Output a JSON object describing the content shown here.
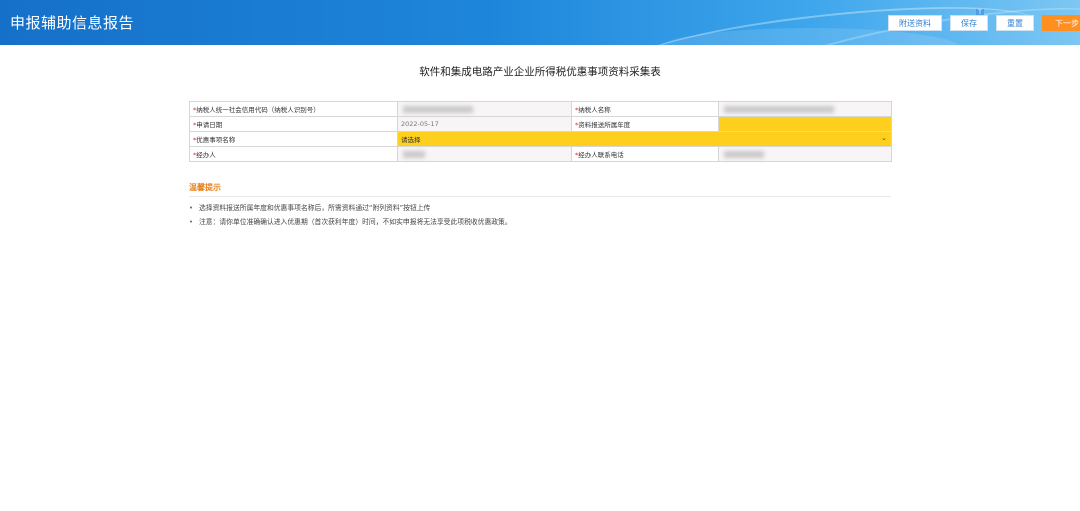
{
  "app": {
    "title": "申报辅助信息报告"
  },
  "toolbar": {
    "attach": "附送资料",
    "save": "保存",
    "reset": "重置",
    "next": "下一步",
    "badge": "T"
  },
  "form": {
    "title": "软件和集成电路产业企业所得税优惠事项资料采集表",
    "required_mark": "*",
    "rows": [
      {
        "label1": "纳税人统一社会信用代码（纳税人识别号）",
        "value1": "",
        "label2": "纳税人名称",
        "value2": ""
      },
      {
        "label1": "申请日期",
        "value1": "2022-05-17",
        "label2": "资料报送所属年度",
        "value2": ""
      },
      {
        "label1": "优惠事项名称",
        "select_value": "请选择"
      },
      {
        "label1": "经办人",
        "value1": "",
        "label2": "经办人联系电话",
        "value2": ""
      }
    ]
  },
  "tips": {
    "title": "温馨提示",
    "items": [
      "选择资料报送所属年度和优惠事项名称后，所需资料通过“附列资料”按钮上传",
      "注意：请你单位准确确认进入优惠期（首次获利年度）时间，不如实申报将无法享受此项税收优惠政策。"
    ]
  },
  "colors": {
    "header_blue": "#1e86da",
    "primary_button": "#ff8f1f",
    "highlight_yellow": "#ffcf1e",
    "required_red": "#e02020",
    "tips_orange": "#e8821e"
  }
}
